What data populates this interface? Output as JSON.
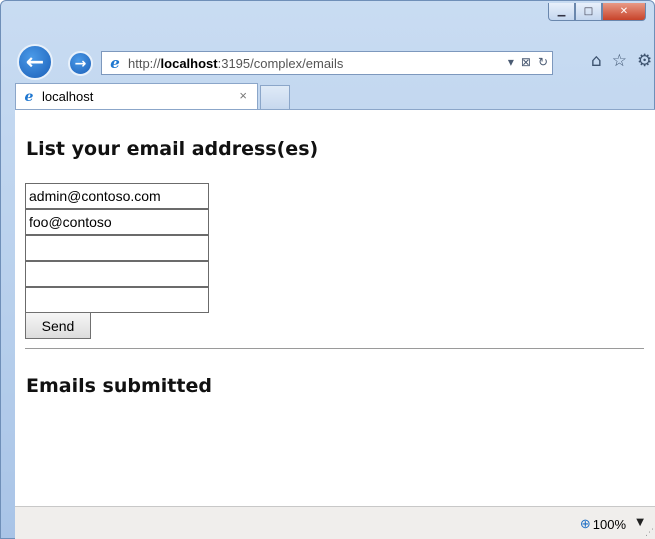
{
  "window": {
    "controls": {
      "minimize": "▁",
      "maximize": "□",
      "close": "✕"
    }
  },
  "nav": {
    "back_icon": "back-arrow-icon",
    "forward_icon": "forward-arrow-icon",
    "address": {
      "prefix": "http://",
      "host": "localhost",
      "rest": ":3195/complex/emails"
    },
    "address_tools": [
      "▾",
      "⊠",
      "↻"
    ],
    "right_icons": [
      "home-icon",
      "star-icon",
      "gear-icon"
    ]
  },
  "tab": {
    "label": "localhost",
    "close": "×"
  },
  "page": {
    "heading": "List your email address(es)",
    "emails": [
      "admin@contoso.com",
      "foo@contoso",
      "",
      "",
      ""
    ],
    "send_label": "Send",
    "submitted_heading": "Emails submitted"
  },
  "status": {
    "zoom": "100%"
  }
}
